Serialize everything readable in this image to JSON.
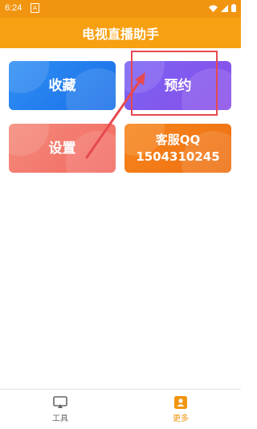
{
  "status_bar": {
    "time": "6:24"
  },
  "header": {
    "title": "电视直播助手"
  },
  "cards": [
    {
      "label": "收藏"
    },
    {
      "label": "预约"
    },
    {
      "label": "设置"
    },
    {
      "label_line1": "客服QQ",
      "label_line2": "1504310245"
    }
  ],
  "tabs": [
    {
      "label": "工具",
      "icon": "cast-screen-icon"
    },
    {
      "label": "更多",
      "icon": "person-card-icon",
      "active": true
    }
  ],
  "colors": {
    "accent": "#f7a012",
    "highlight": "#e6494f"
  }
}
